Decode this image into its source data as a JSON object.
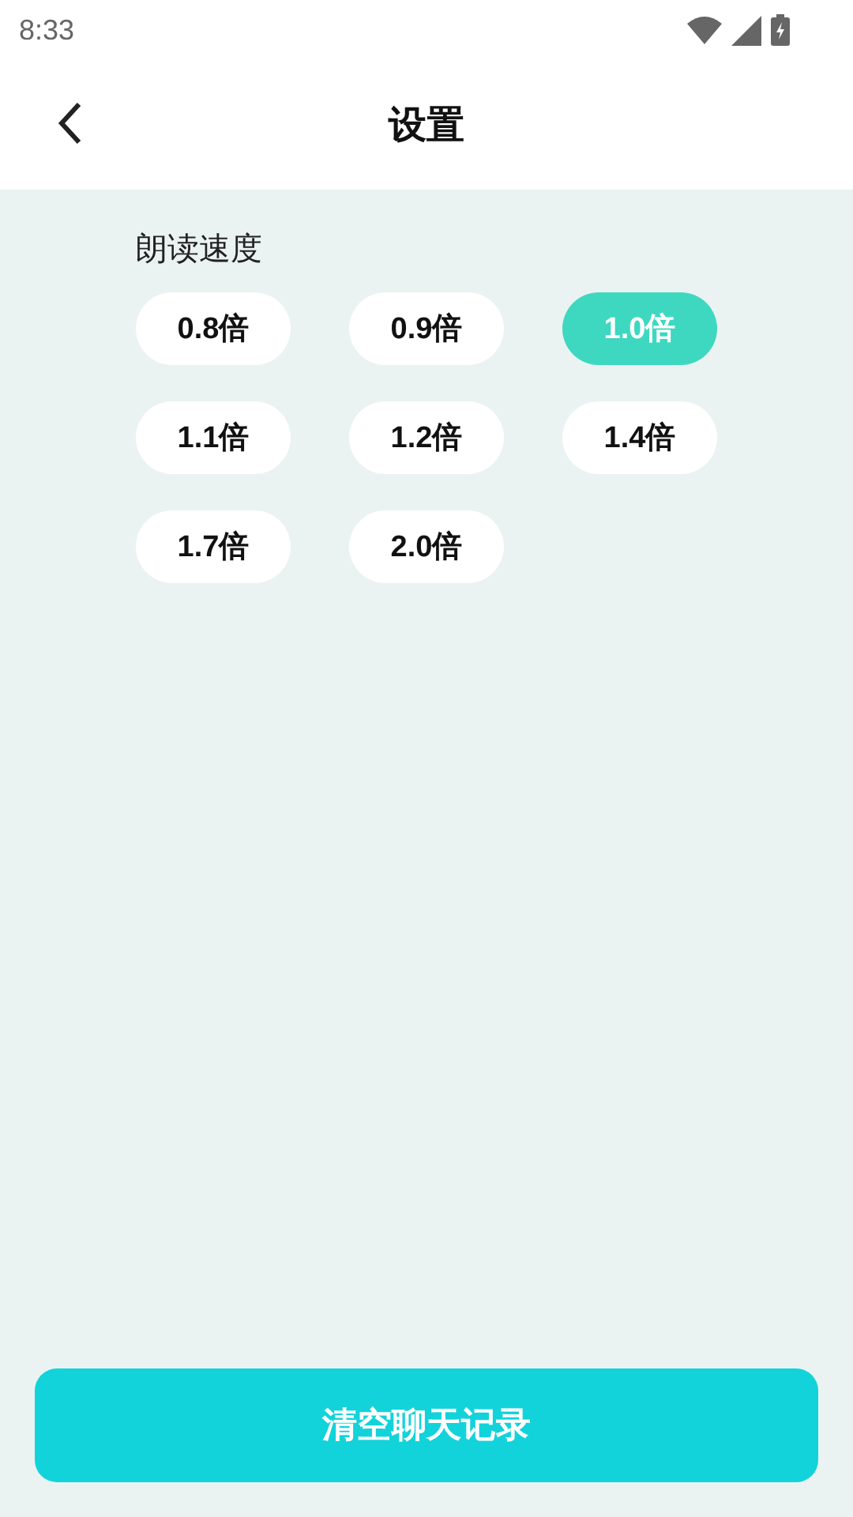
{
  "status_bar": {
    "time": "8:33"
  },
  "header": {
    "title": "设置"
  },
  "section": {
    "label": "朗读速度",
    "options": [
      {
        "label": "0.8倍",
        "selected": false
      },
      {
        "label": "0.9倍",
        "selected": false
      },
      {
        "label": "1.0倍",
        "selected": true
      },
      {
        "label": "1.1倍",
        "selected": false
      },
      {
        "label": "1.2倍",
        "selected": false
      },
      {
        "label": "1.4倍",
        "selected": false
      },
      {
        "label": "1.7倍",
        "selected": false
      },
      {
        "label": "2.0倍",
        "selected": false
      }
    ]
  },
  "footer_button": {
    "label": "清空聊天记录"
  }
}
